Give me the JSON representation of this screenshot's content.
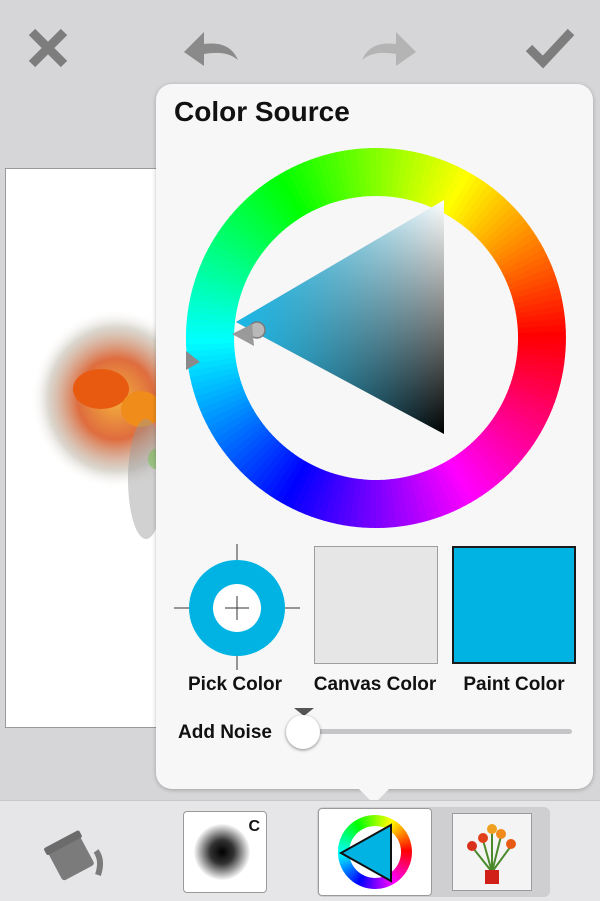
{
  "toolbar": {
    "close_icon": "close-icon",
    "undo_icon": "undo-icon",
    "redo_icon": "redo-icon",
    "confirm_icon": "checkmark-icon"
  },
  "popover": {
    "title": "Color Source",
    "selected_paint_color": "#00b3e3",
    "hue_degrees": 195,
    "color_options": {
      "pick_color": "Pick Color",
      "canvas_color": "Canvas Color",
      "paint_color": "Paint Color"
    },
    "canvas_color_swatch": "#e6e6e6",
    "add_noise": {
      "label": "Add Noise",
      "value": 0
    }
  },
  "bottom_tools": {
    "paint_bucket_icon": "paint-bucket-icon",
    "brush_badge": "C",
    "color_source_icon": "color-wheel-icon",
    "reference_image_icon": "tulip-vase-thumbnail"
  }
}
